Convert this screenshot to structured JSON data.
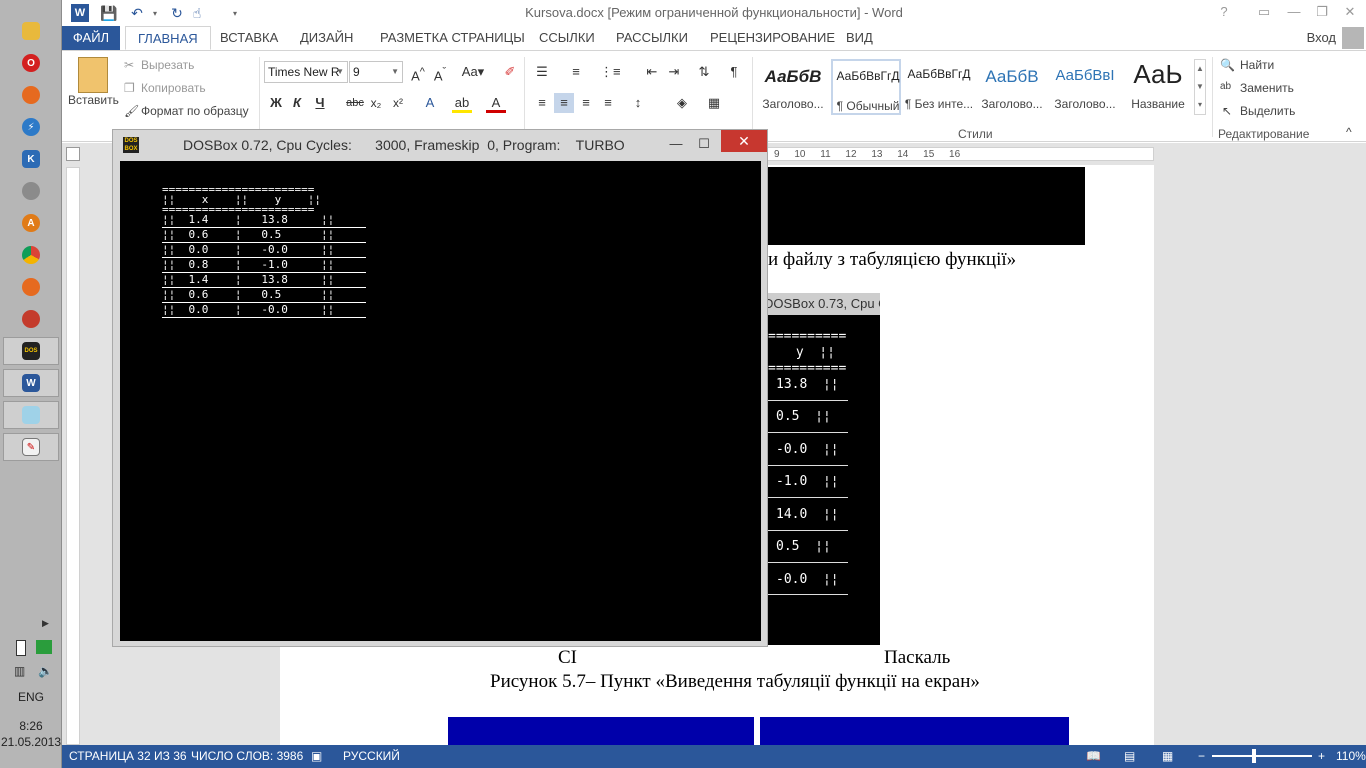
{
  "taskbar": {
    "items": [
      "explorer-icon",
      "opera-icon",
      "firefox-icon",
      "thunderbird-icon",
      "keepass-icon",
      "disk-icon",
      "avast-icon",
      "chrome-icon",
      "mozilla-icon",
      "filezilla-icon",
      "dosbox-icon",
      "word-icon",
      "notepad-icon",
      "paint-icon"
    ],
    "language": "ENG",
    "time": "8:26",
    "date": "21.05.2013"
  },
  "word": {
    "title": "Kursova.docx [Режим ограниченной функциональности] - Word",
    "signin": "Вход",
    "tabs": {
      "file": "ФАЙЛ",
      "home": "ГЛАВНАЯ",
      "insert": "ВСТАВКА",
      "design": "ДИЗАЙН",
      "layout": "РАЗМЕТКА СТРАНИЦЫ",
      "references": "ССЫЛКИ",
      "mailings": "РАССЫЛКИ",
      "review": "РЕЦЕНЗИРОВАНИЕ",
      "view": "ВИД"
    },
    "clipboard": {
      "paste": "Вставить",
      "cut": "Вырезать",
      "copy": "Копировать",
      "format_painter": "Формат по образцу"
    },
    "font": {
      "name": "Times New R",
      "size": "9",
      "bold": "Ж",
      "italic": "К",
      "underline": "Ч",
      "strike": "abc",
      "subscript": "x₂",
      "superscript": "x²"
    },
    "styles": {
      "group_label": "Стили",
      "items": [
        {
          "sample": "АаБбВ",
          "name": "Заголово..."
        },
        {
          "sample": "АаБбВвГгД",
          "name": "¶ Обычный"
        },
        {
          "sample": "АаБбВвГгД",
          "name": "¶ Без инте..."
        },
        {
          "sample": "АаБбВ",
          "name": "Заголово..."
        },
        {
          "sample": "АаБбВвІ",
          "name": "Заголово..."
        },
        {
          "sample": "АаЬ",
          "name": "Название"
        }
      ]
    },
    "editing": {
      "group_label": "Редактирование",
      "find": "Найти",
      "replace": "Заменить",
      "select": "Выделить"
    },
    "ruler_numbers": [
      "9",
      "10",
      "11",
      "12",
      "13",
      "14",
      "15",
      "16"
    ],
    "document": {
      "partial_caption": "и файлу з табуляцією функції»",
      "dos2_title": "DOSBox 0.73, Cpu C",
      "dos2_lines": [
        "==========",
        " y  ¦¦",
        "==========",
        "13.8  ¦¦",
        "0.5  ¦¦",
        "-0.0  ¦¦",
        "-1.0  ¦¦",
        "14.0  ¦¦",
        "0.5  ¦¦",
        "-0.0  ¦¦"
      ],
      "label_ci": "CI",
      "label_pascal": "Паскаль",
      "figure_caption": "Рисунок 5.7–  Пункт «Виведення табуляції функції на екран»"
    },
    "status": {
      "page": "СТРАНИЦА 32 ИЗ 36",
      "words": "ЧИСЛО СЛОВ: 3986",
      "language": "РУССКИЙ",
      "zoom": "110%"
    }
  },
  "dosbox": {
    "title": "DOSBox 0.72, Cpu Cycles:      3000, Frameskip  0, Program:    TURBO",
    "lines": [
      "=======================",
      "¦¦    x    ¦¦    y    ¦¦",
      "=======================",
      "¦¦  1.4    ¦   13.8     ¦¦",
      "¦¦  0.6    ¦   0.5      ¦¦",
      "¦¦  0.0    ¦   -0.0     ¦¦",
      "¦¦  0.8    ¦   -1.0     ¦¦",
      "¦¦  1.4    ¦   13.8     ¦¦",
      "¦¦  0.6    ¦   0.5      ¦¦",
      "¦¦  0.0    ¦   -0.0     ¦¦"
    ]
  }
}
